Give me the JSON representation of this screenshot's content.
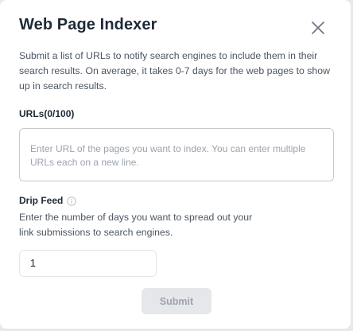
{
  "modal": {
    "title": "Web Page Indexer",
    "description": "Submit a list of URLs to notify search engines to include them in their search results. On average, it takes 0-7 days for the web pages to show up in search results.",
    "close_icon": "close-icon"
  },
  "urls": {
    "label": "URLs(0/100)",
    "value": "",
    "placeholder": "Enter URL of the pages you want to index. You can enter multiple URLs each on a new line."
  },
  "drip_feed": {
    "label": "Drip Feed",
    "info_icon": "info-icon",
    "description": "Enter the number of days you want to spread out your link submissions to search engines.",
    "value": "1"
  },
  "actions": {
    "submit_label": "Submit",
    "submit_disabled": true
  },
  "colors": {
    "title": "#1f2937",
    "body_text": "#4b5563",
    "placeholder": "#9ca3af",
    "button_disabled_bg": "#e5e7eb",
    "button_disabled_text": "#9ca3af",
    "backdrop": "#e9e9e9"
  }
}
